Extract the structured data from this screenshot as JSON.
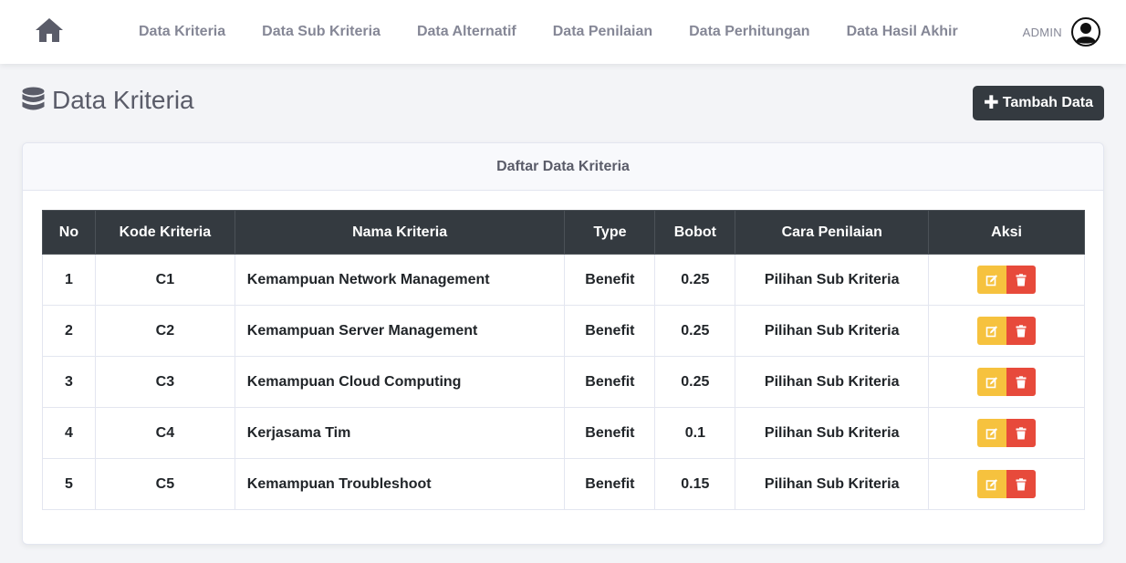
{
  "nav": {
    "home_icon": "home-icon",
    "items": [
      {
        "label": "Data Kriteria"
      },
      {
        "label": "Data Sub Kriteria"
      },
      {
        "label": "Data Alternatif"
      },
      {
        "label": "Data Penilaian"
      },
      {
        "label": "Data Perhitungan"
      },
      {
        "label": "Data Hasil Akhir"
      }
    ],
    "user": {
      "name": "ADMIN",
      "avatar_icon": "user-circle-icon"
    }
  },
  "page": {
    "title": "Data Kriteria",
    "title_icon": "database-icon",
    "add_button": {
      "icon": "plus-icon",
      "label": "Tambah Data"
    }
  },
  "card": {
    "title": "Daftar Data Kriteria",
    "table": {
      "headers": [
        "No",
        "Kode Kriteria",
        "Nama Kriteria",
        "Type",
        "Bobot",
        "Cara Penilaian",
        "Aksi"
      ],
      "rows": [
        {
          "no": "1",
          "kode": "C1",
          "nama": "Kemampuan Network Management",
          "type": "Benefit",
          "bobot": "0.25",
          "cara": "Pilihan Sub Kriteria"
        },
        {
          "no": "2",
          "kode": "C2",
          "nama": "Kemampuan Server Management",
          "type": "Benefit",
          "bobot": "0.25",
          "cara": "Pilihan Sub Kriteria"
        },
        {
          "no": "3",
          "kode": "C3",
          "nama": "Kemampuan Cloud Computing",
          "type": "Benefit",
          "bobot": "0.25",
          "cara": "Pilihan Sub Kriteria"
        },
        {
          "no": "4",
          "kode": "C4",
          "nama": "Kerjasama Tim",
          "type": "Benefit",
          "bobot": "0.1",
          "cara": "Pilihan Sub Kriteria"
        },
        {
          "no": "5",
          "kode": "C5",
          "nama": "Kemampuan Troubleshoot",
          "type": "Benefit",
          "bobot": "0.15",
          "cara": "Pilihan Sub Kriteria"
        }
      ],
      "actions": {
        "edit_icon": "edit-icon",
        "delete_icon": "trash-icon"
      }
    }
  },
  "colors": {
    "topbar": "#ffffff",
    "background": "#f3f4f7",
    "table_header": "#343a40",
    "edit_button": "#f6c23e",
    "delete_button": "#e74a3b",
    "nav_text": "#858796"
  }
}
